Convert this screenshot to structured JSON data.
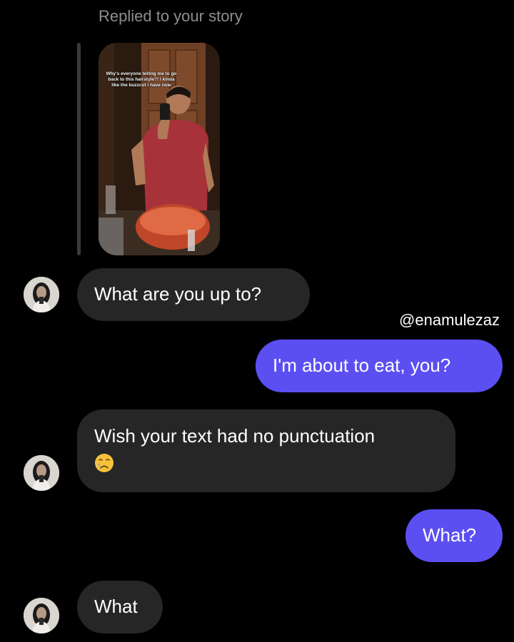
{
  "reply": {
    "caption": "Replied to your story",
    "story_overlay_text": "Why's everyone telling me to go back to this hairstyle?! I kinda like the buzzcut I have now"
  },
  "watermark": {
    "handle": "@enamulezaz"
  },
  "messages": [
    {
      "sender": "them",
      "text": "What are you up to?"
    },
    {
      "sender": "me",
      "text": "I'm about to eat, you?"
    },
    {
      "sender": "them",
      "text": "Wish your text had no punctuation",
      "emoji": "crying-face-icon"
    },
    {
      "sender": "me",
      "text": "What?"
    },
    {
      "sender": "them",
      "text": "What"
    }
  ],
  "colors": {
    "background": "#000000",
    "incoming_bubble": "#262626",
    "outgoing_bubble": "#5b4ff2",
    "caption_text": "#8e8e8e"
  }
}
